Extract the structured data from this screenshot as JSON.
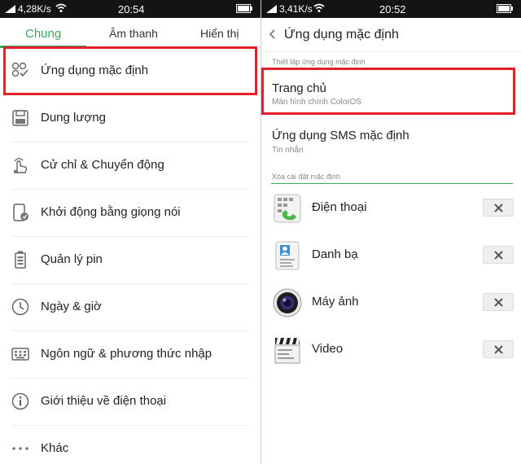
{
  "left": {
    "status": {
      "speed": "4,28K/s",
      "time": "20:54"
    },
    "tabs": [
      "Chung",
      "Âm thanh",
      "Hiển thị"
    ],
    "items": [
      {
        "label": "Ứng dụng mặc định",
        "icon": "default-apps-icon"
      },
      {
        "label": "Dung lượng",
        "icon": "storage-icon"
      },
      {
        "label": "Cử chỉ & Chuyển động",
        "icon": "gesture-icon"
      },
      {
        "label": "Khởi động bằng giọng nói",
        "icon": "voice-launch-icon"
      },
      {
        "label": "Quản lý pin",
        "icon": "battery-icon"
      },
      {
        "label": "Ngày & giờ",
        "icon": "clock-icon"
      },
      {
        "label": "Ngôn ngữ & phương thức nhập",
        "icon": "keyboard-icon"
      },
      {
        "label": "Giới thiệu về điện thoại",
        "icon": "info-icon"
      },
      {
        "label": "Khác",
        "icon": "more-icon"
      }
    ]
  },
  "right": {
    "status": {
      "speed": "3,41K/s",
      "time": "20:52"
    },
    "title": "Ứng dụng mặc định",
    "section_default": "Thiết lập ứng dụng mặc định",
    "home": {
      "title": "Trang chủ",
      "subtitle": "Màn hình chính ColorOS"
    },
    "sms": {
      "title": "Ứng dụng SMS mặc định",
      "subtitle": "Tin nhắn"
    },
    "section_clear": "Xóa cài đặt mặc định",
    "apps": [
      {
        "name": "Điện thoại",
        "icon": "phone-app-icon"
      },
      {
        "name": "Danh bạ",
        "icon": "contacts-app-icon"
      },
      {
        "name": "Máy ảnh",
        "icon": "camera-app-icon"
      },
      {
        "name": "Video",
        "icon": "video-app-icon"
      }
    ]
  },
  "colors": {
    "accent": "#3aa660",
    "highlight": "#e41e2b",
    "statusbar": "#141414"
  }
}
